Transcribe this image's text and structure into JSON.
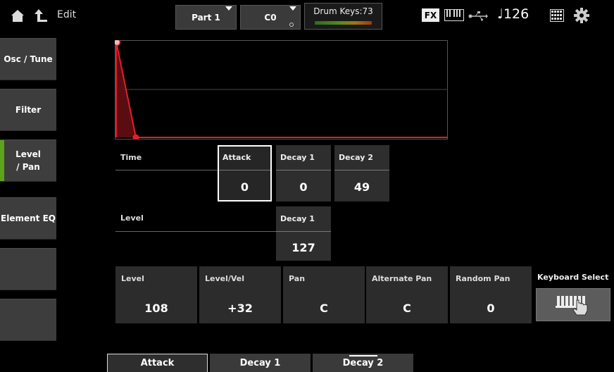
{
  "header": {
    "edit_label": "Edit",
    "part_label": "Part 1",
    "note_label": "C0",
    "drum_keys_label": "Drum Keys:73",
    "fx_label": "FX",
    "tempo": "♩126"
  },
  "sidebar": {
    "items": [
      {
        "label": "Osc / Tune",
        "active": false
      },
      {
        "label": "Filter",
        "active": false
      },
      {
        "label": "Level\n/ Pan",
        "active": true
      },
      {
        "label": "Element EQ",
        "active": false
      },
      {
        "label": "",
        "active": false
      },
      {
        "label": "",
        "active": false
      },
      {
        "label": "",
        "active": false
      }
    ]
  },
  "envelope": {
    "time_label": "Time",
    "level_label": "Level",
    "attack_title": "Attack",
    "attack_value": "0",
    "time_decay1_title": "Decay 1",
    "time_decay1_value": "0",
    "time_decay2_title": "Decay 2",
    "time_decay2_value": "49",
    "level_decay1_title": "Decay 1",
    "level_decay1_value": "127",
    "graph_color": "#e0202a"
  },
  "params": {
    "level_title": "Level",
    "level_value": "108",
    "level_vel_title": "Level/Vel",
    "level_vel_value": "+32",
    "pan_title": "Pan",
    "pan_value": "C",
    "alt_pan_title": "Alternate Pan",
    "alt_pan_value": "C",
    "random_pan_title": "Random Pan",
    "random_pan_value": "0",
    "keyboard_select_label": "Keyboard Select"
  },
  "bottom_tabs": [
    {
      "label": "Attack"
    },
    {
      "label": "Decay 1"
    },
    {
      "label": "Decay 2"
    }
  ],
  "colors": {
    "accent_green": "#5ea31c",
    "envelope_red": "#e0202a"
  }
}
